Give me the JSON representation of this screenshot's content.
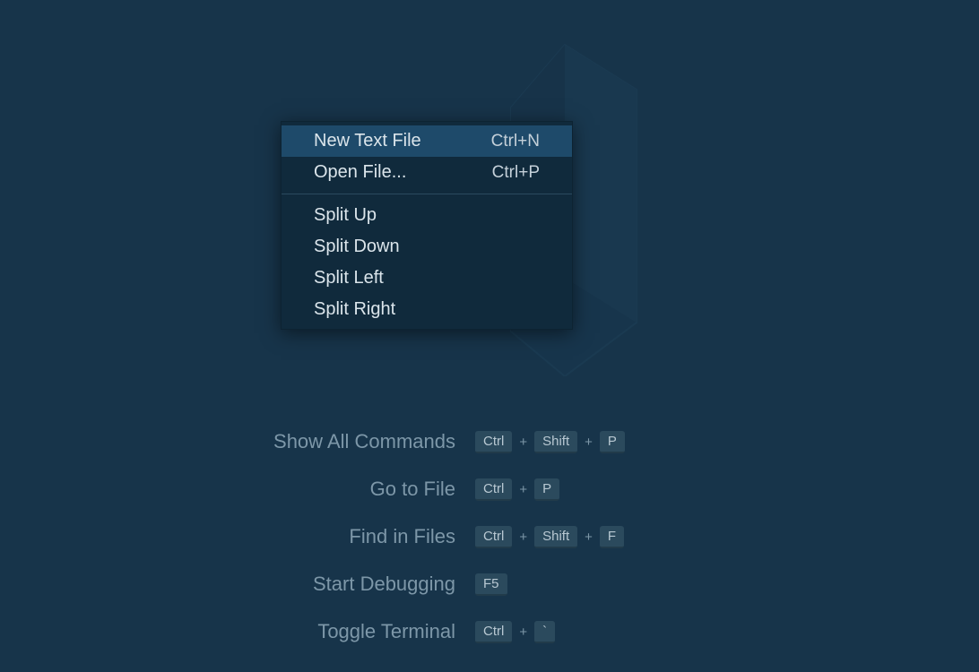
{
  "contextMenu": {
    "items": [
      {
        "label": "New Text File",
        "shortcut": "Ctrl+N",
        "hovered": true
      },
      {
        "label": "Open File...",
        "shortcut": "Ctrl+P",
        "hovered": false
      }
    ],
    "splitItems": [
      {
        "label": "Split Up"
      },
      {
        "label": "Split Down"
      },
      {
        "label": "Split Left"
      },
      {
        "label": "Split Right"
      }
    ]
  },
  "shortcuts": [
    {
      "label": "Show All Commands",
      "keys": [
        "Ctrl",
        "Shift",
        "P"
      ]
    },
    {
      "label": "Go to File",
      "keys": [
        "Ctrl",
        "P"
      ]
    },
    {
      "label": "Find in Files",
      "keys": [
        "Ctrl",
        "Shift",
        "F"
      ]
    },
    {
      "label": "Start Debugging",
      "keys": [
        "F5"
      ]
    },
    {
      "label": "Toggle Terminal",
      "keys": [
        "Ctrl",
        "`"
      ]
    }
  ]
}
